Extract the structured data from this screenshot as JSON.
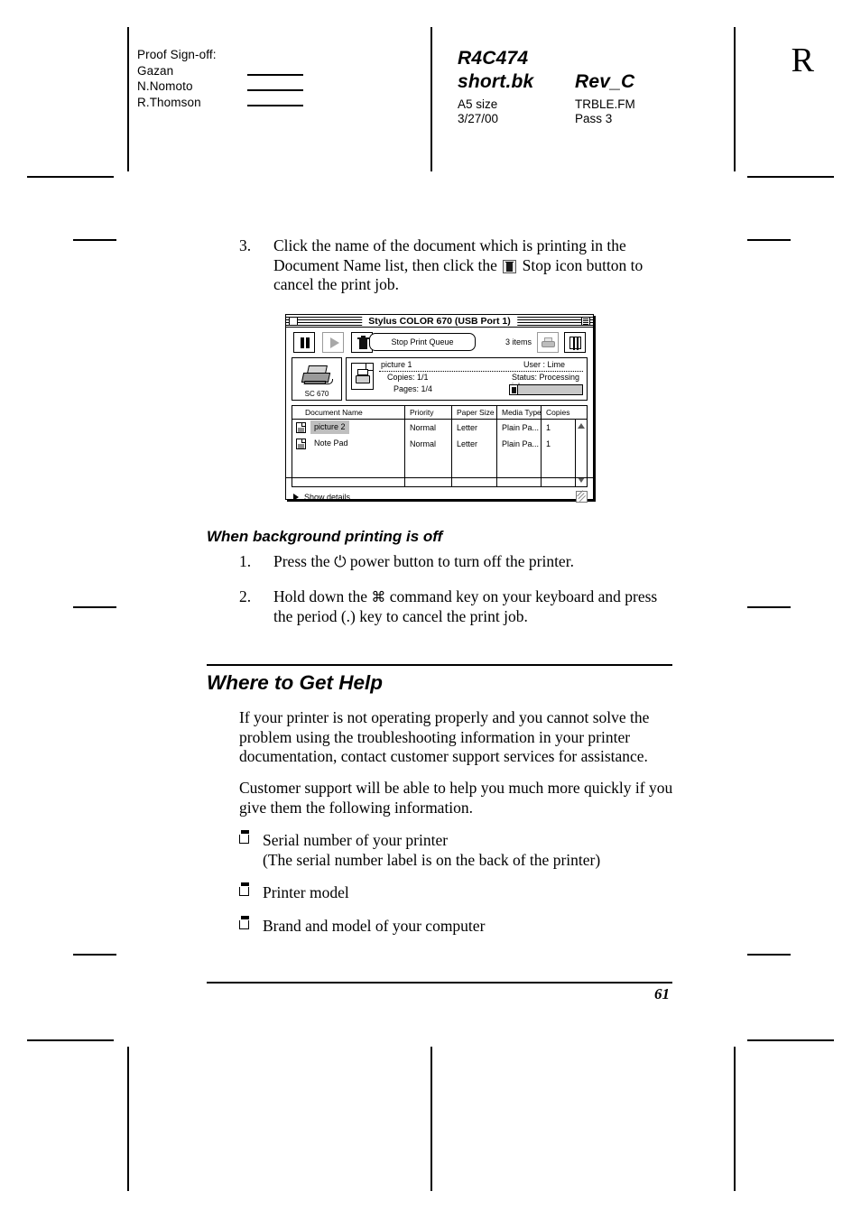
{
  "header": {
    "signoff_title": "Proof Sign-off:",
    "signoff_names": [
      "Gazan",
      "N.Nomoto",
      "R.Thomson"
    ],
    "doc_code": "R4C474",
    "doc_file": "short.bk",
    "revision": "Rev_C",
    "paper_size": "A5 size",
    "date": "3/27/00",
    "source_file": "TRBLE.FM",
    "pass": "Pass 3",
    "rev_letter": "R"
  },
  "step3": {
    "number": "3.",
    "text_part1": "Click the name of the document which is printing in the Document Name list, then click the",
    "text_part2": "Stop icon button to cancel the print job."
  },
  "queue_window": {
    "title": "Stylus COLOR 670 (USB Port 1)",
    "toolbar": {
      "pause_label": "pause-button",
      "resume_label": "resume-button",
      "stop_label": "stop-trash-button",
      "stop_queue_button": "Stop Print Queue",
      "items_count": "3 items",
      "print_selection_label": "print-selection-button",
      "columns_button_label": "columns-button"
    },
    "status": {
      "printer_label": "SC 670",
      "job_name": "picture 1",
      "user": "User : Lime",
      "copies": "Copies: 1/1",
      "job_status": "Status: Processing job.",
      "pages": "Pages: 1/4",
      "progress_percent": 4
    },
    "list": {
      "columns": [
        "Document Name",
        "Priority",
        "Paper Size",
        "Media Type",
        "Copies"
      ],
      "rows": [
        {
          "name": "picture 2",
          "priority": "Normal",
          "paper_size": "Letter",
          "media_type": "Plain Pa...",
          "copies": "1",
          "selected": true
        },
        {
          "name": "Note Pad",
          "priority": "Normal",
          "paper_size": "Letter",
          "media_type": "Plain Pa...",
          "copies": "1",
          "selected": false
        }
      ]
    },
    "footer": {
      "show_details": "Show details"
    }
  },
  "bg_printing_section": {
    "heading": "When background printing is off",
    "steps": [
      {
        "number": "1.",
        "text_part1": "Press the",
        "text_part2": "power button to turn off the printer."
      },
      {
        "number": "2.",
        "text_part1": "Hold down the",
        "text_part2": "command key on your keyboard and press the period (.) key to cancel the print job."
      }
    ]
  },
  "help_section": {
    "heading": "Where to Get Help",
    "paragraphs": [
      "If your printer is not operating properly and you cannot solve the problem using the troubleshooting information in your printer documentation, contact customer support services for assistance.",
      "Customer support will be able to help you much more quickly if you give them the following information."
    ],
    "bullets": [
      "Serial number of your printer\n(The serial number label is on the back of the printer)",
      "Printer model",
      "Brand and model of your computer"
    ]
  },
  "footer": {
    "page_number": "61"
  }
}
